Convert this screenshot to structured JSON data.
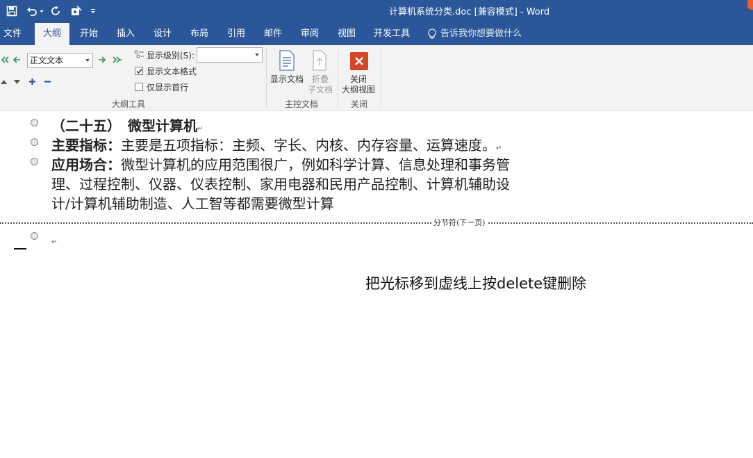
{
  "titlebar": {
    "title": "计算机系统分类.doc [兼容模式] - Word",
    "qat": [
      "save-icon",
      "undo-icon",
      "redo-icon",
      "touch-mode-icon",
      "customize-icon"
    ]
  },
  "tabs": [
    {
      "label": "文件",
      "active": false
    },
    {
      "label": "大纲",
      "active": true
    },
    {
      "label": "开始",
      "active": false
    },
    {
      "label": "插入",
      "active": false
    },
    {
      "label": "设计",
      "active": false
    },
    {
      "label": "布局",
      "active": false
    },
    {
      "label": "引用",
      "active": false
    },
    {
      "label": "邮件",
      "active": false
    },
    {
      "label": "审阅",
      "active": false
    },
    {
      "label": "视图",
      "active": false
    },
    {
      "label": "开发工具",
      "active": false
    }
  ],
  "tellme": "告诉我你想要做什么",
  "ribbon": {
    "outline_tools": {
      "level_value": "正文文本",
      "show_level_label": "显示级别(S):",
      "show_level_value": "",
      "show_text_format_label": "显示文本格式",
      "show_text_format_checked": true,
      "first_line_only_label": "仅显示首行",
      "first_line_only_checked": false,
      "group_label": "大纲工具"
    },
    "master_document": {
      "show_document_label": "显示文档",
      "collapse_sub_line1": "折叠",
      "collapse_sub_line2": "子文档",
      "group_label": "主控文档"
    },
    "close": {
      "close_line1": "关闭",
      "close_line2": "大纲视图",
      "group_label": "关闭"
    }
  },
  "document": {
    "items": [
      {
        "bold": "（二十五）　微型计算机",
        "text": ""
      },
      {
        "bold": "主要指标：",
        "text": "主要是五项指标：主频、字长、内核、内存容量、运算速度。"
      },
      {
        "bold": "应用场合：",
        "text": "微型计算机的应用范围很广，例如科学计算、信息处理和事务管"
      }
    ],
    "continuation": [
      "理、过程控制、仪器、仪表控制、家用电器和民用产品控制、计算机辅助设",
      "计/计算机辅助制造、人工智等都需要微型计算"
    ],
    "section_break": "分节符(下一页)",
    "annotation": "把光标移到虚线上按delete键删除"
  },
  "colors": {
    "word_blue": "#2b579a",
    "ribbon_bg": "#f3f3f3",
    "close_red": "#d24726"
  }
}
